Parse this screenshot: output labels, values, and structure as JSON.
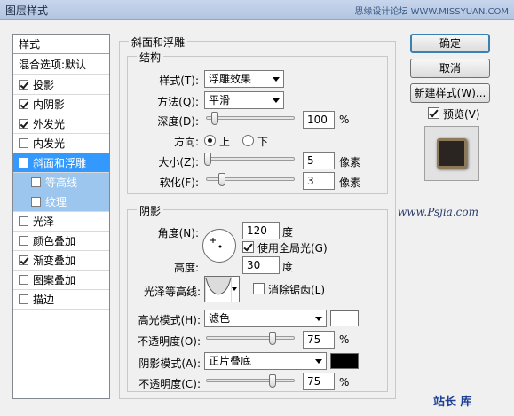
{
  "window": {
    "title": "图层样式",
    "watermark": "思缘设计论坛 WWW.MISSYUAN.COM"
  },
  "styles_list": {
    "header": "样式",
    "blend_default": "混合选项:默认",
    "items": [
      {
        "label": "投影",
        "checked": true
      },
      {
        "label": "内阴影",
        "checked": true
      },
      {
        "label": "外发光",
        "checked": true
      },
      {
        "label": "内发光",
        "checked": false
      },
      {
        "label": "斜面和浮雕",
        "checked": true,
        "selected": true
      },
      {
        "label": "等高线",
        "checked": false,
        "sub": true
      },
      {
        "label": "纹理",
        "checked": false,
        "sub": true
      },
      {
        "label": "光泽",
        "checked": false
      },
      {
        "label": "颜色叠加",
        "checked": false
      },
      {
        "label": "渐变叠加",
        "checked": true
      },
      {
        "label": "图案叠加",
        "checked": false
      },
      {
        "label": "描边",
        "checked": false
      }
    ]
  },
  "bevel_group": {
    "title": "斜面和浮雕",
    "structure": {
      "title": "结构",
      "style_label": "样式(T):",
      "style_value": "浮雕效果",
      "technique_label": "方法(Q):",
      "technique_value": "平滑",
      "depth_label": "深度(D):",
      "depth_value": "100",
      "depth_unit": "%",
      "depth_fraction": 0.1,
      "direction_label": "方向:",
      "direction_up": "上",
      "direction_down": "下",
      "size_label": "大小(Z):",
      "size_value": "5",
      "size_unit": "像素",
      "size_fraction": 0.02,
      "soften_label": "软化(F):",
      "soften_value": "3",
      "soften_unit": "像素",
      "soften_fraction": 0.18
    },
    "shading": {
      "title": "阴影",
      "angle_label": "角度(N):",
      "angle_value": "120",
      "angle_unit": "度",
      "global_light_label": "使用全局光(G)",
      "altitude_label": "高度:",
      "altitude_value": "30",
      "altitude_unit": "度",
      "gloss_contour_label": "光泽等高线:",
      "anti_alias_label": "消除锯齿(L)",
      "highlight_mode_label": "高光模式(H):",
      "highlight_mode_value": "滤色",
      "highlight_color": "#ffffff",
      "highlight_opacity_label": "不透明度(O):",
      "highlight_opacity_value": "75",
      "highlight_opacity_fraction": 0.75,
      "shadow_mode_label": "阴影模式(A):",
      "shadow_mode_value": "正片叠底",
      "shadow_color": "#000000",
      "shadow_opacity_label": "不透明度(C):",
      "shadow_opacity_value": "75",
      "shadow_opacity_fraction": 0.75,
      "percent_unit": "%"
    }
  },
  "buttons": {
    "ok": "确定",
    "cancel": "取消",
    "new_style": "新建样式(W)...",
    "preview_label": "预览(V)"
  },
  "branding": {
    "site": "www.Psjia.com",
    "logo": "站长 库"
  }
}
